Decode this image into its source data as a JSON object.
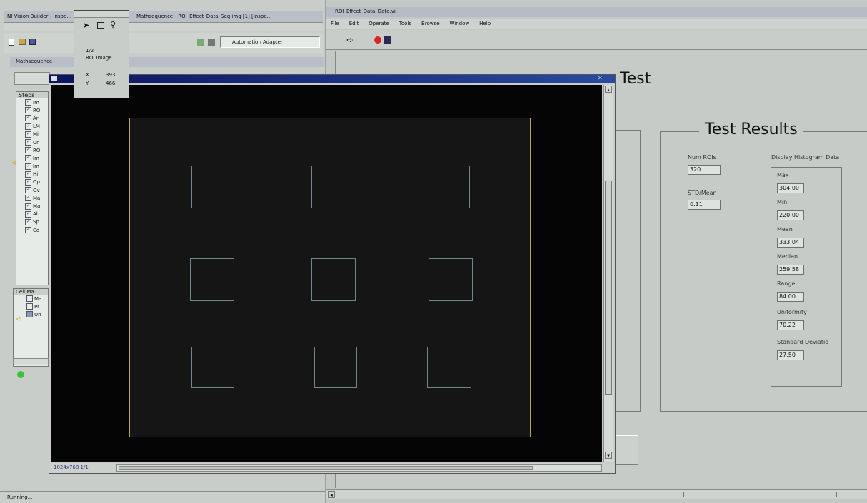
{
  "left_app": {
    "title": "NI Vision Builder - Inspe…",
    "toolbar_path": "Mathsequence - ROI_Effect_Data_Seq.img [1] [Inspe…",
    "pad_left": "Automation Adapter",
    "panel_title": "Mathsequence",
    "steps_label": "Steps",
    "tree_items": [
      "Im",
      "RO",
      "Ari",
      "LM",
      "Mi",
      "Un",
      "RO",
      "Im",
      "Im",
      "Hi",
      "Op",
      "Ov",
      "Ma",
      "Ma",
      "Ab",
      "Sp",
      "Co"
    ],
    "bottom_panel_label": "Cell Ma",
    "bottom_items": [
      "Ma",
      "Pr",
      "Un"
    ],
    "status": "Running..."
  },
  "overlay_palette": {
    "line1": "1/2",
    "line2": "ROI Image",
    "x_label": "X",
    "x_val": "393",
    "y_label": "Y",
    "y_val": "466"
  },
  "image_window": {
    "footer_text": "1024x768 1/1",
    "roi_count": 9
  },
  "right_app": {
    "title": "ROI_Effect_Data_Data.vi",
    "menu": [
      "File",
      "Edit",
      "Operate",
      "Tools",
      "Browse",
      "Window",
      "Help"
    ],
    "front_title": "Test",
    "results_title": "Test Results",
    "num_rois_label": "Num ROIs",
    "num_rois": "320",
    "std_mean_label": "STD/Mean",
    "std_mean": "0.11",
    "histogram_label": "Display Histogram Data",
    "hist": [
      {
        "label": "Max",
        "value": "304.00"
      },
      {
        "label": "Min",
        "value": "220.00"
      },
      {
        "label": "Mean",
        "value": "333.04"
      },
      {
        "label": "Median",
        "value": "259.58"
      },
      {
        "label": "Range",
        "value": "84.00"
      },
      {
        "label": "Uniformity",
        "value": "70.22"
      },
      {
        "label": "Standard Deviatio",
        "value": "27.50"
      }
    ]
  }
}
